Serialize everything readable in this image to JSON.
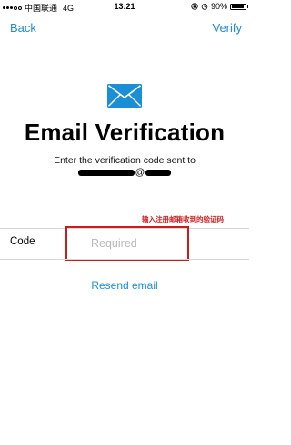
{
  "status_bar": {
    "carrier": "中国联通",
    "network": "4G",
    "time": "13:21",
    "battery": "90%",
    "battery_level": 0.9
  },
  "nav": {
    "back_label": "Back",
    "verify_label": "Verify"
  },
  "header": {
    "title": "Email Verification",
    "subtitle": "Enter the verification code sent to",
    "email_at": "@"
  },
  "annotation": "输入注册邮箱收到的验证码",
  "form": {
    "code_label": "Code",
    "code_value": "",
    "code_placeholder": "Required"
  },
  "resend_label": "Resend email",
  "colors": {
    "accent": "#1a8fd6",
    "highlight": "#c91d1d"
  }
}
